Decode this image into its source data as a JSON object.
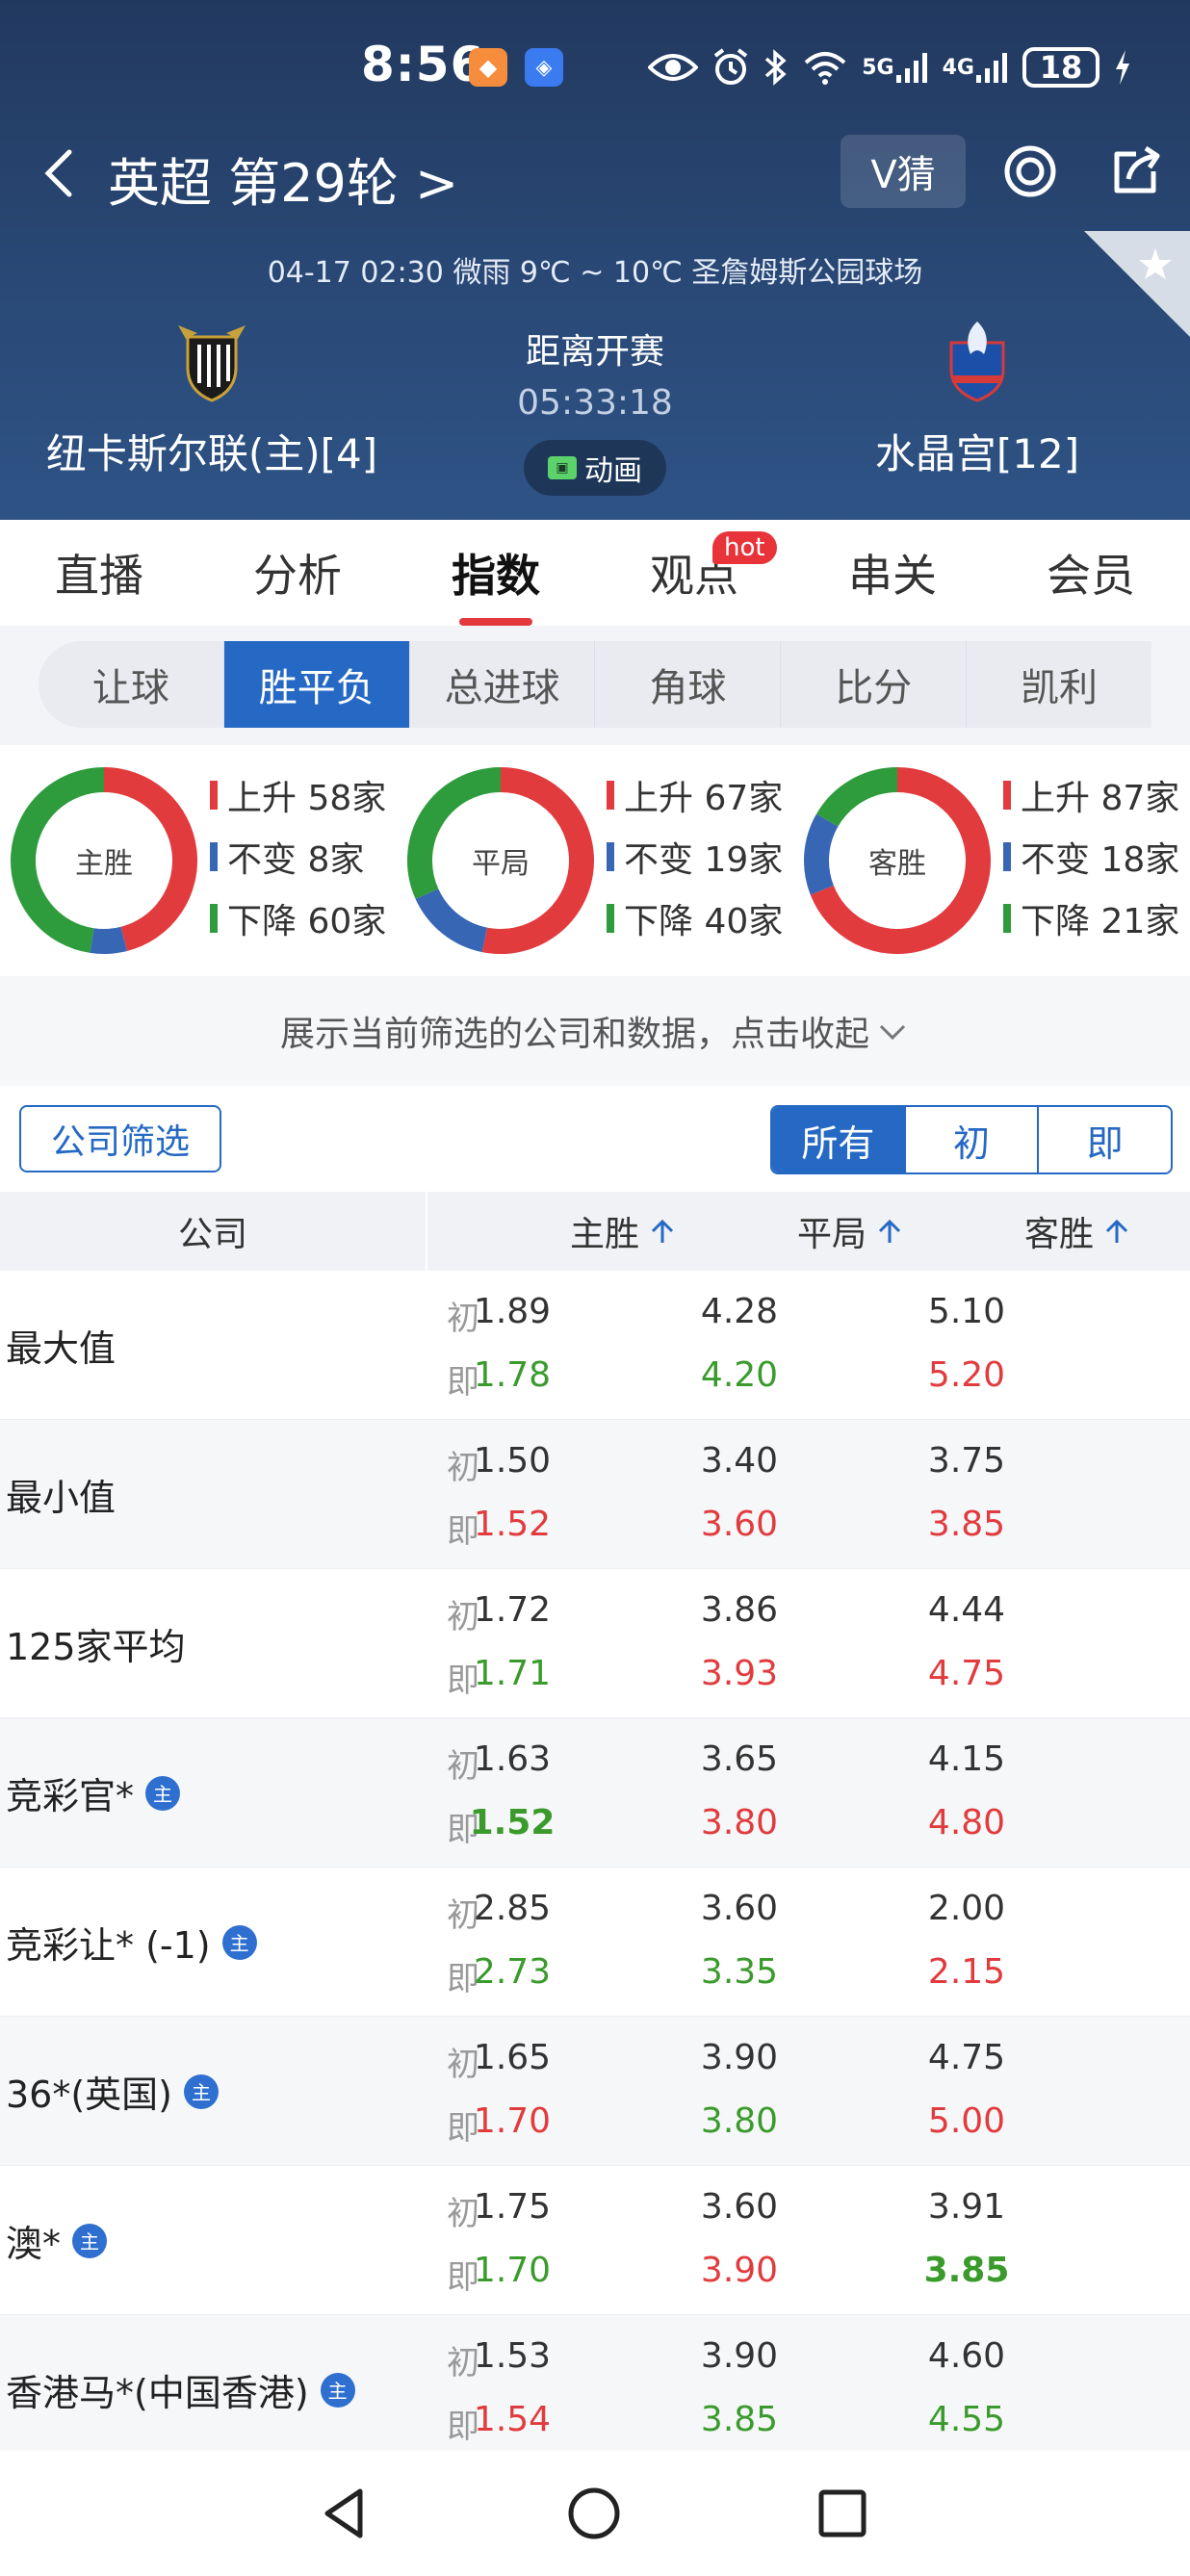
{
  "status_bar": {
    "time": "8:56",
    "battery": "18",
    "net_5g": "5G",
    "net_4g": "4G"
  },
  "header": {
    "league": "英超 第29轮 >",
    "vguess": "V猜",
    "match_info": "04-17 02:30   微雨 9℃ ~ 10℃   圣詹姆斯公园球场",
    "home_team": "纽卡斯尔联(主)[4]",
    "away_team": "水晶宫[12]",
    "countdown_label": "距离开赛",
    "countdown_time": "05:33:18",
    "animation_label": "动画"
  },
  "main_tabs": [
    {
      "label": "直播",
      "active": false
    },
    {
      "label": "分析",
      "active": false
    },
    {
      "label": "指数",
      "active": true
    },
    {
      "label": "观点",
      "active": false,
      "badge": "hot"
    },
    {
      "label": "串关",
      "active": false
    },
    {
      "label": "会员",
      "active": false
    }
  ],
  "sub_tabs": [
    {
      "label": "让球",
      "active": false
    },
    {
      "label": "胜平负",
      "active": true
    },
    {
      "label": "总进球",
      "active": false
    },
    {
      "label": "角球",
      "active": false
    },
    {
      "label": "比分",
      "active": false
    },
    {
      "label": "凯利",
      "active": false
    }
  ],
  "colors": {
    "up": "#e23b3e",
    "same": "#3766b5",
    "down": "#2e9c3c",
    "accent": "#2669c4"
  },
  "donuts": [
    {
      "label": "主胜",
      "up": 58,
      "same": 8,
      "down": 60,
      "lines": [
        "上升 58家",
        "不变 8家",
        "下降 60家"
      ]
    },
    {
      "label": "平局",
      "up": 67,
      "same": 19,
      "down": 40,
      "lines": [
        "上升 67家",
        "不变 19家",
        "下降 40家"
      ]
    },
    {
      "label": "客胜",
      "up": 87,
      "same": 18,
      "down": 21,
      "lines": [
        "上升 87家",
        "不变 18家",
        "下降 21家"
      ]
    }
  ],
  "collapse_text": "展示当前筛选的公司和数据，点击收起",
  "filter": {
    "company_filter": "公司筛选",
    "segments": [
      {
        "label": "所有",
        "active": true
      },
      {
        "label": "初",
        "active": false
      },
      {
        "label": "即",
        "active": false
      }
    ]
  },
  "table": {
    "headers": {
      "company": "公司",
      "home": "主胜",
      "draw": "平局",
      "away": "客胜"
    },
    "tag_initial": "初",
    "tag_live": "即",
    "main_badge": "主",
    "rows": [
      {
        "name": "最大值",
        "badge": false,
        "init": [
          "1.89",
          "4.28",
          "5.10"
        ],
        "live": [
          "1.78",
          "4.20",
          "5.20"
        ],
        "trend": [
          "down",
          "down",
          "up"
        ],
        "bold": [
          false,
          false,
          false
        ]
      },
      {
        "name": "最小值",
        "badge": false,
        "init": [
          "1.50",
          "3.40",
          "3.75"
        ],
        "live": [
          "1.52",
          "3.60",
          "3.85"
        ],
        "trend": [
          "up",
          "up",
          "up"
        ],
        "bold": [
          false,
          false,
          false
        ]
      },
      {
        "name": "125家平均",
        "badge": false,
        "init": [
          "1.72",
          "3.86",
          "4.44"
        ],
        "live": [
          "1.71",
          "3.93",
          "4.75"
        ],
        "trend": [
          "down",
          "up",
          "up"
        ],
        "bold": [
          false,
          false,
          false
        ]
      },
      {
        "name": "竞彩官*",
        "badge": true,
        "init": [
          "1.63",
          "3.65",
          "4.15"
        ],
        "live": [
          "1.52",
          "3.80",
          "4.80"
        ],
        "trend": [
          "down",
          "up",
          "up"
        ],
        "bold": [
          true,
          false,
          false
        ]
      },
      {
        "name": "竞彩让* (-1)",
        "badge": true,
        "init": [
          "2.85",
          "3.60",
          "2.00"
        ],
        "live": [
          "2.73",
          "3.35",
          "2.15"
        ],
        "trend": [
          "down",
          "down",
          "up"
        ],
        "bold": [
          false,
          false,
          false
        ]
      },
      {
        "name": "36*(英国)",
        "badge": true,
        "init": [
          "1.65",
          "3.90",
          "4.75"
        ],
        "live": [
          "1.70",
          "3.80",
          "5.00"
        ],
        "trend": [
          "up",
          "down",
          "up"
        ],
        "bold": [
          false,
          false,
          false
        ]
      },
      {
        "name": "澳*",
        "badge": true,
        "init": [
          "1.75",
          "3.60",
          "3.91"
        ],
        "live": [
          "1.70",
          "3.90",
          "3.85"
        ],
        "trend": [
          "down",
          "up",
          "down"
        ],
        "bold": [
          false,
          false,
          true
        ]
      },
      {
        "name": "香港马*(中国香港)",
        "badge": true,
        "init": [
          "1.53",
          "3.90",
          "4.60"
        ],
        "live": [
          "1.54",
          "3.85",
          "4.55"
        ],
        "trend": [
          "up",
          "down",
          "down"
        ],
        "bold": [
          false,
          false,
          false
        ]
      }
    ]
  }
}
